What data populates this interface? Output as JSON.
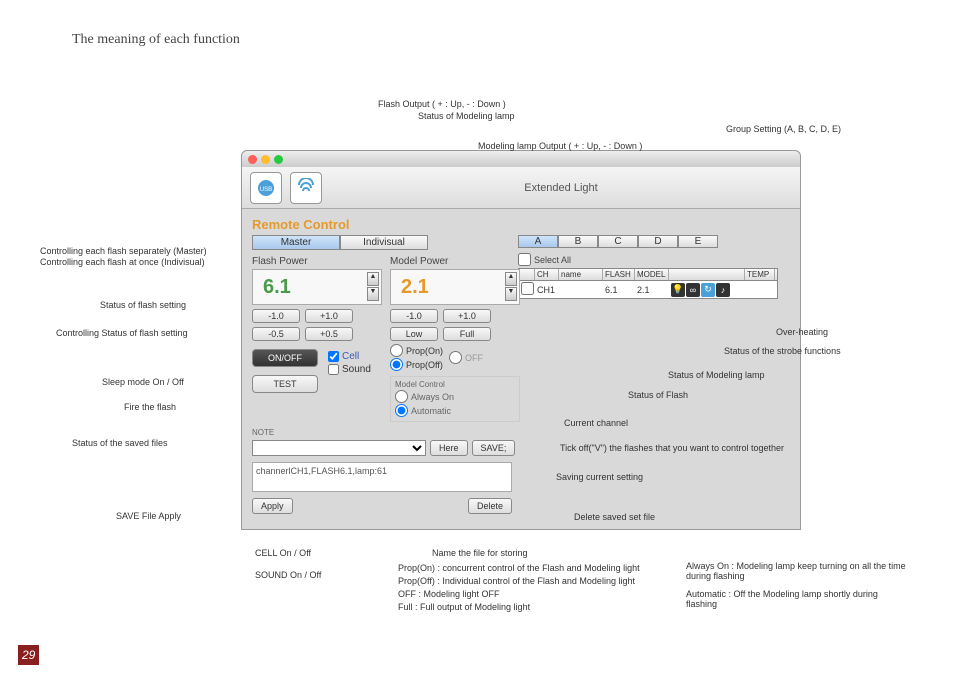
{
  "page": {
    "title": "The meaning of each function",
    "number": "29"
  },
  "window": {
    "title": "Extended Light",
    "rc_title": "Remote Control",
    "tabs": {
      "master": "Master",
      "individual": "Indivisual"
    },
    "groups": [
      "A",
      "B",
      "C",
      "D",
      "E"
    ],
    "flash": {
      "label": "Flash Power",
      "value": "6.1",
      "minus1": "-1.0",
      "plus1": "+1.0",
      "minus05": "-0.5",
      "plus05": "+0.5"
    },
    "model": {
      "label": "Model Power",
      "value": "2.1",
      "minus1": "-1.0",
      "plus1": "+1.0",
      "low": "Low",
      "full": "Full"
    },
    "onoff": "ON/OFF",
    "test": "TEST",
    "cell": "Cell",
    "sound": "Sound",
    "prop_on": "Prop(On)",
    "prop_off": "Prop(Off)",
    "off": "OFF",
    "mc_title": "Model Control",
    "always": "Always On",
    "auto": "Automatic",
    "note": "NOTE",
    "here": "Here",
    "save_as": "SAVE;",
    "apply": "Apply",
    "delete": "Delete",
    "note_content": "channerlCH1,FLASH6.1,lamp:61",
    "select_all": "Select All",
    "hdr": {
      "ch": "CH",
      "name": "name",
      "flash": "FLASH",
      "model": "MODEL",
      "temp": "TEMP"
    },
    "row": {
      "ch": "CH1",
      "flash": "6.1",
      "model": "2.1"
    }
  },
  "callouts": {
    "c1": "Controlling each flash separately (Master)",
    "c2": "Controlling each flash at once (Indivisual)",
    "c3": "Status of flash setting",
    "c4": "Controlling Status of flash setting",
    "c5": "Sleep mode On / Off",
    "c6": "Fire the flash",
    "c7": "Status of the saved files",
    "c8": "SAVE File Apply",
    "c9": "CELL On / Off",
    "c10": "SOUND On / Off",
    "c11": "Flash Output ( + : Up, - : Down )",
    "c12": "Status of Modeling lamp",
    "c13": "Modeling lamp Output ( + : Up, - : Down )",
    "c14": "Group Setting (A, B, C, D, E)",
    "c15": "Over-heating",
    "c16": "Status of the strobe functions",
    "c17": "Status of Modeling lamp",
    "c18": "Status of Flash",
    "c19": "Current channel",
    "c20": "Tick off(\"V\") the flashes that you want to control together",
    "c21": "Saving current setting",
    "c22": "Delete saved set file",
    "c23": "Name the file for storing",
    "c24": "Prop(On) : concurrent control of the Flash and Modeling light",
    "c25": "Prop(Off) : Individual control of the Flash and Modeling light",
    "c26": "OFF : Modeling light OFF",
    "c27": "Full : Full output of Modeling light",
    "c28": "Always On : Modeling lamp keep turning on all the time during flashing",
    "c29": "Automatic : Off the Modeling lamp shortly during flashing"
  }
}
